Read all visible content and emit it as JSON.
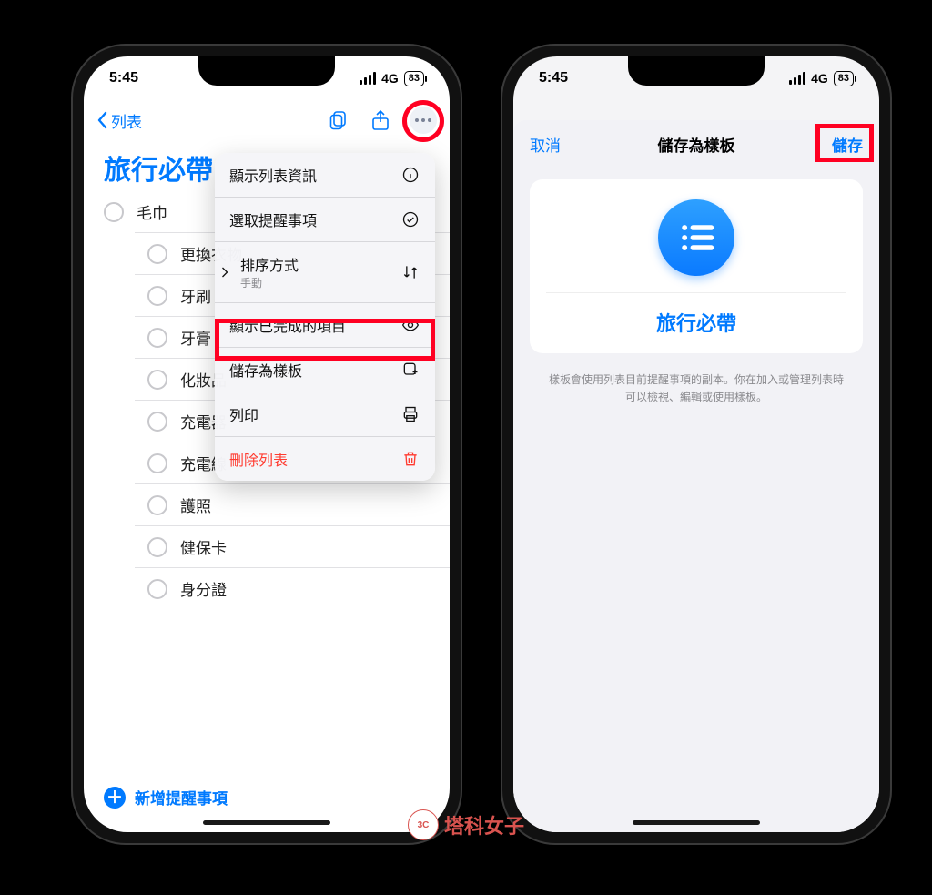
{
  "status": {
    "time": "5:45",
    "network": "4G",
    "battery": "83"
  },
  "left": {
    "back_label": "列表",
    "list_title": "旅行必帶",
    "items": [
      "毛巾",
      "更換衣物",
      "牙刷",
      "牙膏",
      "化妝品",
      "充電器",
      "充電線",
      "護照",
      "健保卡",
      "身分證"
    ],
    "new_reminder_label": "新增提醒事項",
    "menu": {
      "show_info": "顯示列表資訊",
      "select_items": "選取提醒事項",
      "sort_label": "排序方式",
      "sort_value": "手動",
      "show_completed": "顯示已完成的項目",
      "save_template": "儲存為樣板",
      "print": "列印",
      "delete_list": "刪除列表"
    }
  },
  "right": {
    "cancel": "取消",
    "title": "儲存為樣板",
    "save": "儲存",
    "template_name": "旅行必帶",
    "hint": "樣板會使用列表目前提醒事項的副本。你在加入或管理列表時可以檢視、編輯或使用樣板。"
  },
  "watermark": "塔科女子"
}
